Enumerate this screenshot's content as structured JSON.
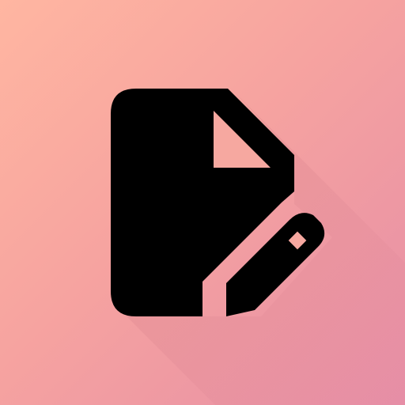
{
  "icon": {
    "name": "edit-document-icon",
    "description_hidden": "",
    "colors": {
      "background_start": "#ffb6a1",
      "background_mid": "#f6a3a0",
      "background_end": "#e68ea6",
      "glyph": "#000000",
      "long_shadow": "#b95f73"
    }
  }
}
